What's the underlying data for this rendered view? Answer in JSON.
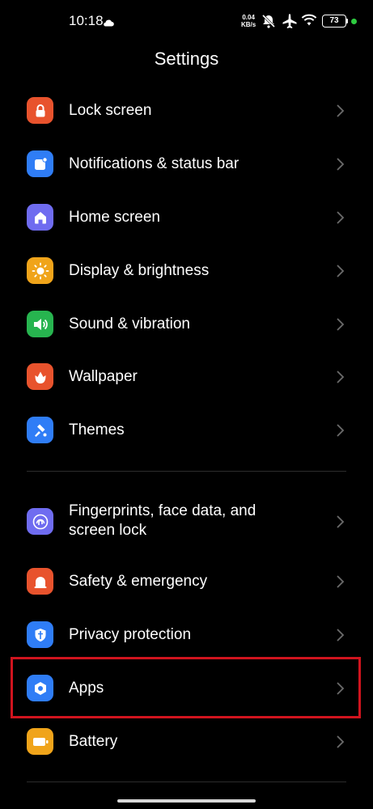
{
  "status_bar": {
    "time": "10:18",
    "net_speed_value": "0.04",
    "net_speed_unit": "KB/s",
    "battery": "73",
    "icons": [
      "cloud-icon",
      "mute-icon",
      "airplane-icon",
      "wifi-icon",
      "battery-icon",
      "active-dot-icon"
    ]
  },
  "header": {
    "title": "Settings"
  },
  "colors": {
    "background": "#000000",
    "text": "#ffffff",
    "chevron": "#6b6b6b",
    "highlight_border": "#d0141e",
    "divider": "#2c2c2c"
  },
  "sections": [
    {
      "items": [
        {
          "label": "Lock screen",
          "icon": "lock-icon",
          "color": "#e8532d"
        },
        {
          "label": "Notifications & status bar",
          "icon": "notification-icon",
          "color": "#2f7df6"
        },
        {
          "label": "Home screen",
          "icon": "home-icon",
          "color": "#6f6cf0"
        },
        {
          "label": "Display & brightness",
          "icon": "sun-icon",
          "color": "#f0a41a"
        },
        {
          "label": "Sound & vibration",
          "icon": "speaker-icon",
          "color": "#27b44f"
        },
        {
          "label": "Wallpaper",
          "icon": "flower-icon",
          "color": "#e8532d"
        },
        {
          "label": "Themes",
          "icon": "brush-icon",
          "color": "#2f7df6"
        }
      ]
    },
    {
      "items": [
        {
          "label_line1": "Fingerprints, face data, and",
          "label_line2": "screen lock",
          "icon": "fingerprint-icon",
          "color": "#6f6cf0"
        },
        {
          "label": "Safety & emergency",
          "icon": "emergency-icon",
          "color": "#e8532d"
        },
        {
          "label": "Privacy protection",
          "icon": "shield-icon",
          "color": "#2f7df6"
        },
        {
          "label": "Apps",
          "icon": "apps-gear-icon",
          "color": "#2f7df6",
          "highlighted": true
        },
        {
          "label": "Battery",
          "icon": "battery-icon",
          "color": "#f0a41a"
        }
      ]
    }
  ]
}
